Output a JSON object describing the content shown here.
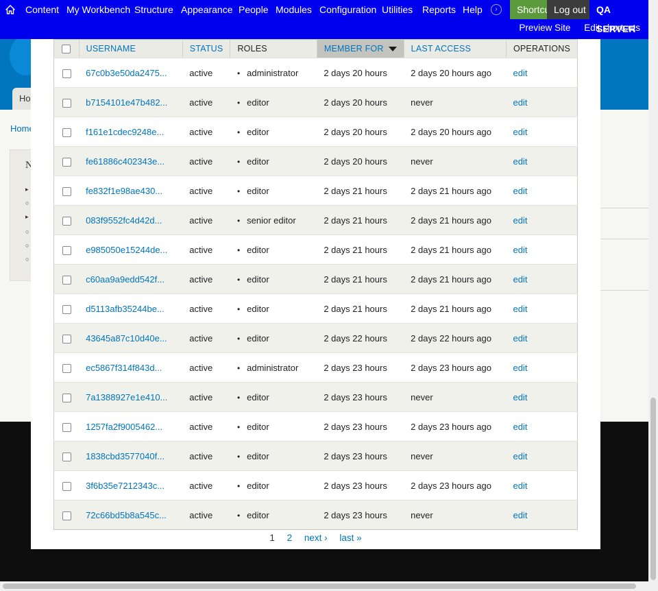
{
  "toolbar": {
    "items": [
      "Content",
      "My Workbench",
      "Structure",
      "Appearance",
      "People",
      "Modules",
      "Configuration",
      "Utilities",
      "Reports",
      "Help"
    ],
    "shortcuts": "Shortcuts",
    "logout": "Log out",
    "server": "QA SERVER",
    "preview_site": "Preview Site",
    "edit_shortcuts": "Edit shortcuts"
  },
  "background": {
    "tab": "Hom",
    "breadcrumb": "Home",
    "panel_letter": "N"
  },
  "table": {
    "headers": {
      "username": "USERNAME",
      "status": "STATUS",
      "roles": "ROLES",
      "member_for": "MEMBER FOR",
      "last_access": "LAST ACCESS",
      "operations": "OPERATIONS"
    },
    "rows": [
      {
        "username": "67c0b3e50da2475...",
        "status": "active",
        "role": "administrator",
        "member_for": "2 days 20 hours",
        "last_access": "2 days 20 hours ago",
        "op": "edit"
      },
      {
        "username": "b7154101e47b482...",
        "status": "active",
        "role": "editor",
        "member_for": "2 days 20 hours",
        "last_access": "never",
        "op": "edit"
      },
      {
        "username": "f161e1cdec9248e...",
        "status": "active",
        "role": "editor",
        "member_for": "2 days 20 hours",
        "last_access": "2 days 20 hours ago",
        "op": "edit"
      },
      {
        "username": "fe61886c402343e...",
        "status": "active",
        "role": "editor",
        "member_for": "2 days 20 hours",
        "last_access": "never",
        "op": "edit"
      },
      {
        "username": "fe832f1e98ae430...",
        "status": "active",
        "role": "editor",
        "member_for": "2 days 21 hours",
        "last_access": "2 days 21 hours ago",
        "op": "edit"
      },
      {
        "username": "083f9552fc4d42d...",
        "status": "active",
        "role": "senior editor",
        "member_for": "2 days 21 hours",
        "last_access": "2 days 21 hours ago",
        "op": "edit"
      },
      {
        "username": "e985050e15244de...",
        "status": "active",
        "role": "editor",
        "member_for": "2 days 21 hours",
        "last_access": "2 days 21 hours ago",
        "op": "edit"
      },
      {
        "username": "c60aa9a9edd542f...",
        "status": "active",
        "role": "editor",
        "member_for": "2 days 21 hours",
        "last_access": "2 days 21 hours ago",
        "op": "edit"
      },
      {
        "username": "d5113afb35244be...",
        "status": "active",
        "role": "editor",
        "member_for": "2 days 21 hours",
        "last_access": "2 days 21 hours ago",
        "op": "edit"
      },
      {
        "username": "43645a87c10d40e...",
        "status": "active",
        "role": "editor",
        "member_for": "2 days 22 hours",
        "last_access": "2 days 22 hours ago",
        "op": "edit"
      },
      {
        "username": "ec5867f314f843d...",
        "status": "active",
        "role": "administrator",
        "member_for": "2 days 23 hours",
        "last_access": "2 days 23 hours ago",
        "op": "edit"
      },
      {
        "username": "7a1388927e1e410...",
        "status": "active",
        "role": "editor",
        "member_for": "2 days 23 hours",
        "last_access": "never",
        "op": "edit"
      },
      {
        "username": "1257fa2f9005462...",
        "status": "active",
        "role": "editor",
        "member_for": "2 days 23 hours",
        "last_access": "2 days 23 hours ago",
        "op": "edit"
      },
      {
        "username": "1838cbd3577040f...",
        "status": "active",
        "role": "editor",
        "member_for": "2 days 23 hours",
        "last_access": "never",
        "op": "edit"
      },
      {
        "username": "3f6b35e7212343c...",
        "status": "active",
        "role": "editor",
        "member_for": "2 days 23 hours",
        "last_access": "2 days 23 hours ago",
        "op": "edit"
      },
      {
        "username": "72c66bd5b8a545c...",
        "status": "active",
        "role": "editor",
        "member_for": "2 days 23 hours",
        "last_access": "never",
        "op": "edit"
      }
    ]
  },
  "pager": {
    "current": "1",
    "page2": "2",
    "next": "next ›",
    "last": "last »"
  },
  "colors": {
    "toolbar": "#0000ee",
    "link": "#0074bd",
    "shortcuts_bg": "#5b9a3c",
    "logout_bg": "#3c3c3c"
  }
}
